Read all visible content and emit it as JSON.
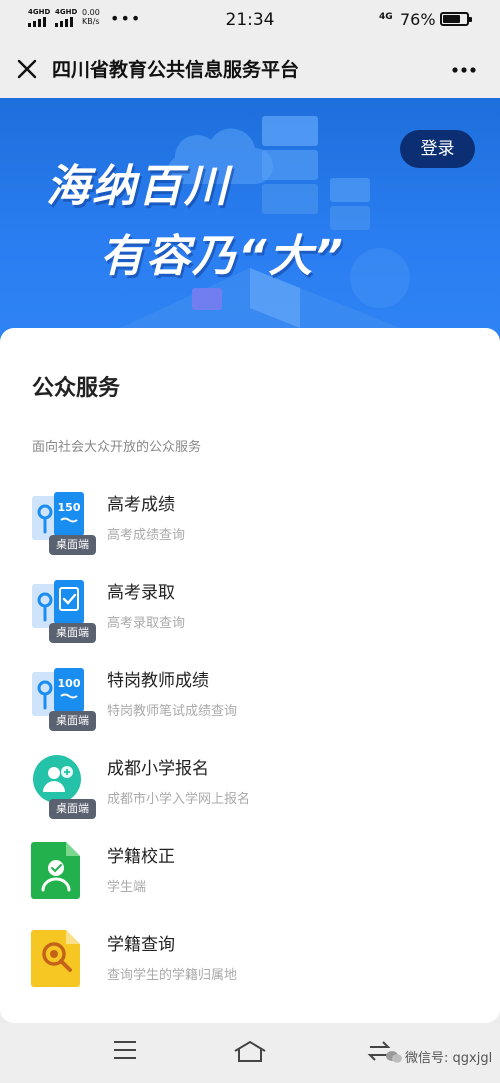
{
  "status_bar": {
    "sim1": "4GHD",
    "sim2": "4GHD",
    "speed_value": "0.00",
    "speed_unit": "KB/s",
    "overflow": "•••",
    "time": "21:34",
    "network": "4G",
    "battery_percent": "76%",
    "battery_level": 0.76
  },
  "nav": {
    "title": "四川省教育公共信息服务平台",
    "close_icon": "close-icon",
    "more_icon": "more-icon"
  },
  "banner": {
    "slogan_line1": "海纳百川",
    "slogan_line2": "有容乃“大”",
    "login_label": "登录"
  },
  "services": {
    "title": "公众服务",
    "subtitle": "面向社会大众开放的公众服务",
    "items": [
      {
        "name": "高考成绩",
        "desc": "高考成绩查询",
        "badge": "桌面端",
        "icon": "score-icon",
        "icon_text": "150"
      },
      {
        "name": "高考录取",
        "desc": "高考录取查询",
        "badge": "桌面端",
        "icon": "admission-icon"
      },
      {
        "name": "特岗教师成绩",
        "desc": "特岗教师笔试成绩查询",
        "badge": "桌面端",
        "icon": "teacher-score-icon",
        "icon_text": "100"
      },
      {
        "name": "成都小学报名",
        "desc": "成都市小学入学网上报名",
        "badge": "桌面端",
        "icon": "enroll-icon"
      },
      {
        "name": "学籍校正",
        "desc": "学生端",
        "icon": "student-record-correction-icon"
      },
      {
        "name": "学籍查询",
        "desc": "查询学生的学籍归属地",
        "icon": "student-record-search-icon"
      }
    ]
  },
  "bottom_nav": {
    "menu_icon": "menu-icon",
    "home_icon": "home-icon",
    "switch_icon": "switch-icon",
    "watermark": "微信号: qgxjgl"
  },
  "colors": {
    "banner_blue": "#2a7df0",
    "login_bg": "#0c2f73",
    "badge_bg": "#5a6170",
    "icon_blue": "#1a8ef0",
    "icon_teal": "#24c2a8",
    "icon_green": "#22b14c",
    "icon_yellow": "#f6c623"
  }
}
